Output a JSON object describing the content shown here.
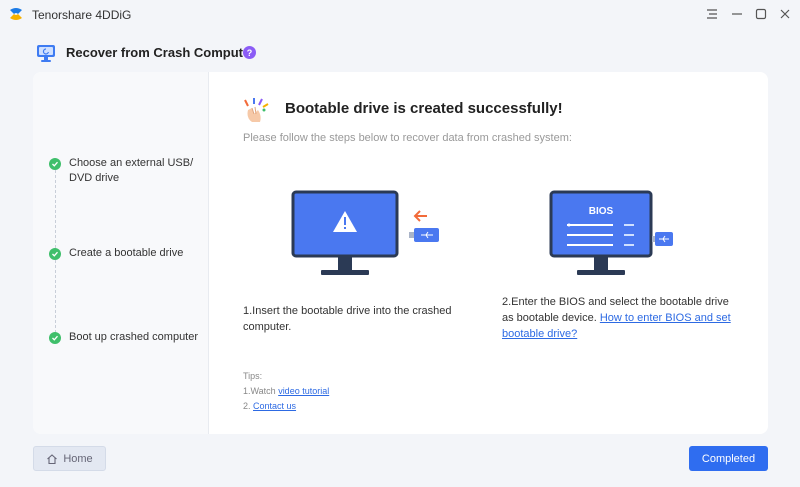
{
  "app": {
    "title": "Tenorshare 4DDiG"
  },
  "header": {
    "title": "Recover from Crash Computer",
    "help_glyph": "?"
  },
  "sidebar": {
    "steps": [
      {
        "label": "Choose an external USB/ DVD drive",
        "status": "done"
      },
      {
        "label": "Create a bootable drive",
        "status": "done"
      },
      {
        "label": "Boot up crashed computer",
        "status": "done"
      }
    ]
  },
  "main": {
    "title": "Bootable drive is created successfully!",
    "subtitle": "Please follow the steps below to recover data from crashed system:",
    "illustration2_label": "BIOS",
    "step1": {
      "text": "1.Insert the bootable drive into the crashed computer."
    },
    "step2": {
      "text": "2.Enter the BIOS and select the bootable drive as bootable device. ",
      "link": "How to enter BIOS and set bootable drive?"
    },
    "tips": {
      "heading": "Tips:",
      "item1_prefix": "1.Watch ",
      "item1_link": "video tutorial",
      "item2_prefix": "2. ",
      "item2_link": "Contact us"
    }
  },
  "footer": {
    "home_label": "Home",
    "completed_label": "Completed"
  },
  "colors": {
    "accent": "#2f6df0",
    "success": "#3fbf6b",
    "monitor": "#4a78f0",
    "help": "#8b5cf6",
    "arrow": "#f26b3a"
  }
}
